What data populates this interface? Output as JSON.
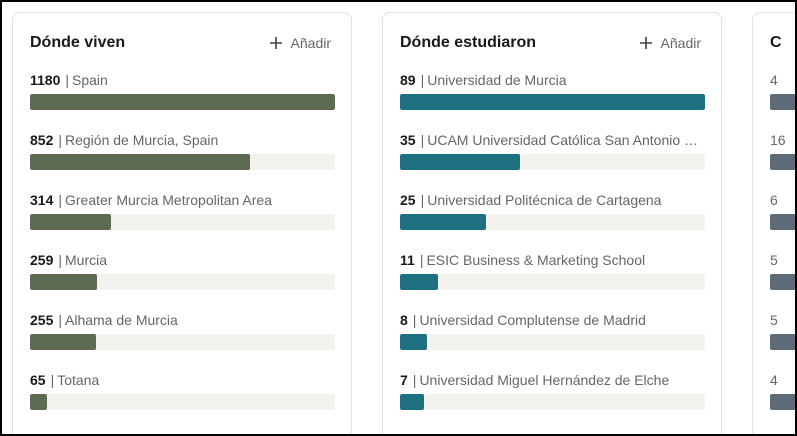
{
  "colors": {
    "where_live_bar": "#5c6b51",
    "where_studied_bar": "#1e7080",
    "third_bar": "#5f6b79"
  },
  "where_live": {
    "title": "Dónde viven",
    "add_label": "Añadir",
    "max": 1180,
    "items": [
      {
        "count": "1180",
        "label": "Spain",
        "value": 1180
      },
      {
        "count": "852",
        "label": "Región de Murcia, Spain",
        "value": 852
      },
      {
        "count": "314",
        "label": "Greater Murcia Metropolitan Area",
        "value": 314
      },
      {
        "count": "259",
        "label": "Murcia",
        "value": 259
      },
      {
        "count": "255",
        "label": "Alhama de Murcia",
        "value": 255
      },
      {
        "count": "65",
        "label": "Totana",
        "value": 65
      }
    ]
  },
  "where_studied": {
    "title": "Dónde estudiaron",
    "add_label": "Añadir",
    "max": 89,
    "items": [
      {
        "count": "89",
        "label": "Universidad de Murcia",
        "value": 89
      },
      {
        "count": "35",
        "label": "UCAM Universidad Católica San Antonio de Murcia",
        "value": 35
      },
      {
        "count": "25",
        "label": "Universidad Politécnica de Cartagena",
        "value": 25
      },
      {
        "count": "11",
        "label": "ESIC Business & Marketing School",
        "value": 11
      },
      {
        "count": "8",
        "label": "Universidad Complutense de Madrid",
        "value": 8
      },
      {
        "count": "7",
        "label": "Universidad Miguel Hernández de Elche",
        "value": 7
      }
    ]
  },
  "third_card": {
    "title": "C",
    "max": 16,
    "items": [
      {
        "count": "4",
        "value": 4
      },
      {
        "count": "16",
        "value": 16
      },
      {
        "count": "6",
        "value": 6
      },
      {
        "count": "5",
        "value": 5
      },
      {
        "count": "5",
        "value": 5
      },
      {
        "count": "4",
        "value": 4
      }
    ]
  }
}
